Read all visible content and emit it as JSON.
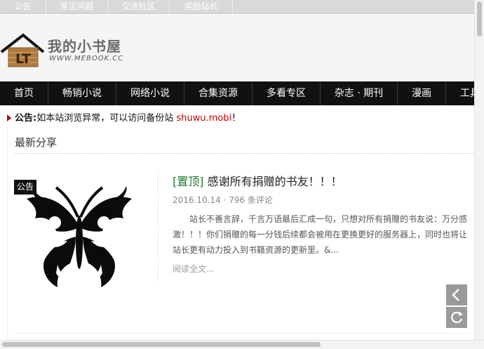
{
  "topbar": {
    "links": [
      "公告",
      "常见问题",
      "交流社区",
      "奖励站长"
    ]
  },
  "logo": {
    "cn_text": "我的小书屋",
    "en_text": "WWW.MEBOOK.CC",
    "badge_letters": "LT"
  },
  "nav": {
    "items": [
      "首页",
      "畅销小说",
      "网络小说",
      "合集资源",
      "多看专区",
      "杂志 · 期刊",
      "漫画",
      "工具"
    ]
  },
  "notice": {
    "label": "公告:",
    "text": "如本站浏览异常，可以访问备份站 ",
    "link": "shuwu.mobi",
    "suffix": "！"
  },
  "section": {
    "title": "最新分享"
  },
  "post": {
    "tag": "公告",
    "pin": "[置顶]",
    "title": " 感谢所有捐赠的书友！！！",
    "date": "2016.10.14",
    "sep": " · ",
    "comments": "796 条评论",
    "excerpt": "站长不善言辞，千言万语最后汇成一句，只想对所有捐赠的书友说：万分感激！！！你们捐赠的每一分钱后续都会被用在更换更好的服务器上，同时也将让站长更有动力投入到书籍资源的更新里。&...",
    "read_more": "阅读全文..."
  },
  "icons": {
    "back": "chevron-left-icon",
    "refresh": "refresh-icon"
  }
}
